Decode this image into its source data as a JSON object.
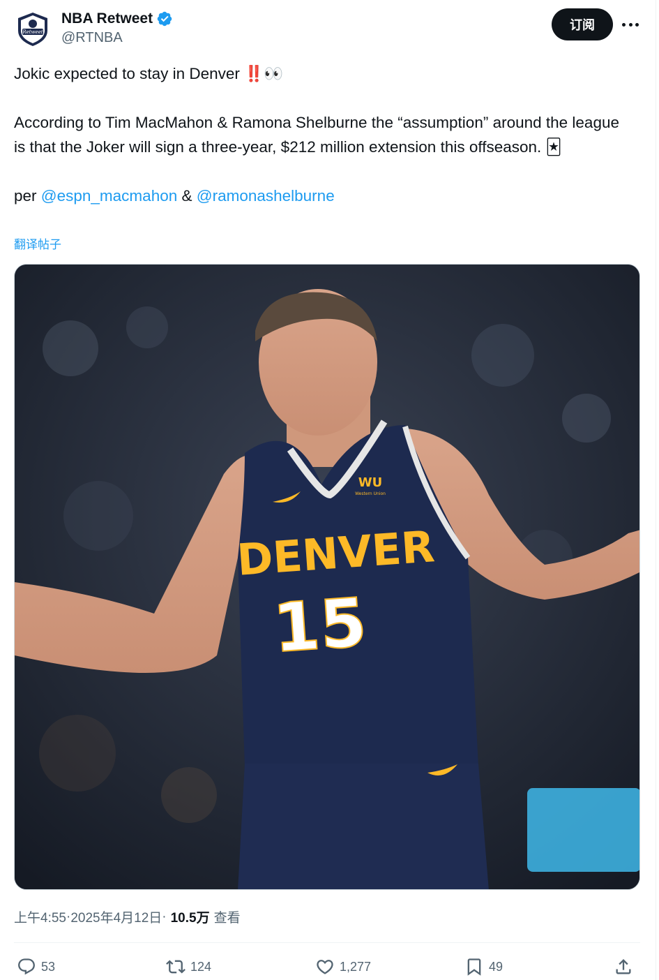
{
  "author": {
    "display_name": "NBA Retweet",
    "handle": "@RTNBA",
    "avatar_text": "Retweet",
    "verified": true
  },
  "header": {
    "subscribe_label": "订阅"
  },
  "tweet": {
    "line1": "Jokic expected to stay in Denver ‼️👀",
    "line2": "According to Tim MacMahon & Ramona Shelburne the “assumption” around the league is that the Joker will sign a three-year, $212 million extension this offseason. 🃏",
    "per_prefix": "per ",
    "mention1": "@espn_macmahon",
    "amp": " & ",
    "mention2": "@ramonashelburne",
    "translate_label": "翻译帖子"
  },
  "media": {
    "jersey_text": "DENVER",
    "jersey_number": "15",
    "sponsor_text": "WU",
    "sponsor_sub": "Western Union"
  },
  "meta": {
    "time": "上午4:55",
    "sep1": " · ",
    "date": "2025年4月12日",
    "sep2": " · ",
    "views_count": "10.5万",
    "views_label": "查看"
  },
  "actions": {
    "replies": "53",
    "reposts": "124",
    "likes": "1,277",
    "bookmarks": "49"
  },
  "colors": {
    "accent": "#1d9bf0",
    "text": "#0f1419",
    "secondary": "#536471",
    "jersey_navy": "#1d2a4f",
    "jersey_gold": "#fdb927"
  }
}
